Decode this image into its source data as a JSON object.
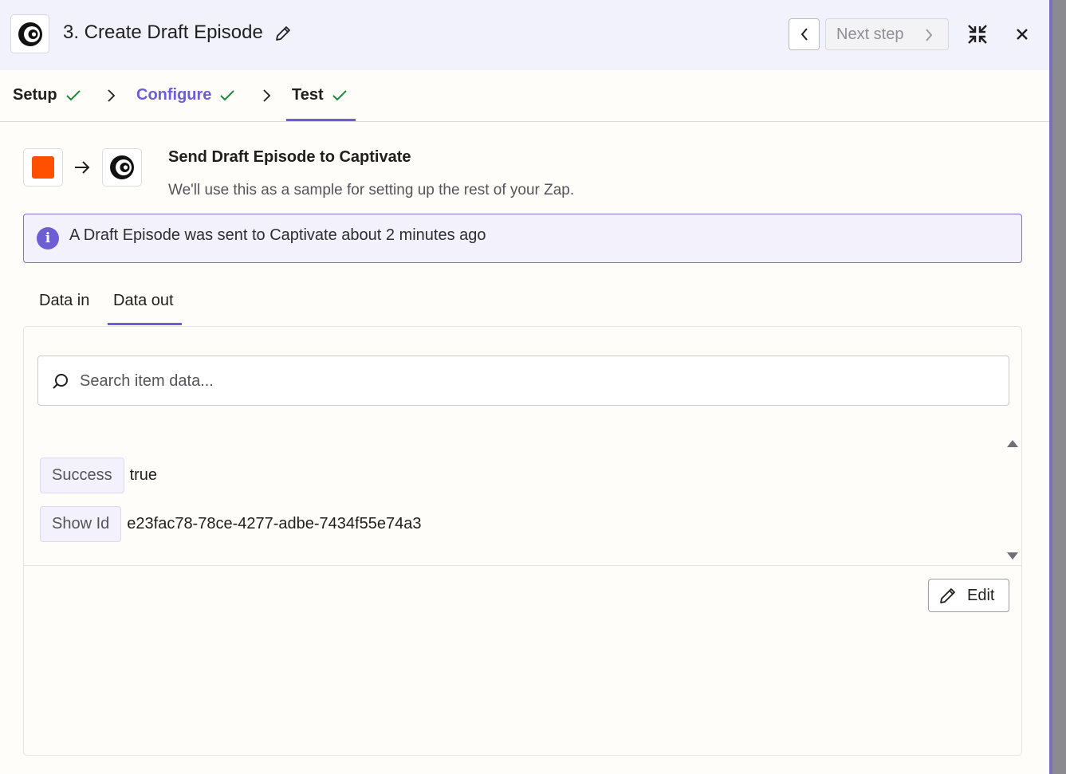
{
  "header": {
    "title": "3. Create Draft Episode",
    "next_step_label": "Next step"
  },
  "steps": [
    {
      "label": "Setup",
      "done": true
    },
    {
      "label": "Configure",
      "done": true,
      "active_color": "#6b5fd3"
    },
    {
      "label": "Test",
      "done": true,
      "current": true
    }
  ],
  "action": {
    "heading": "Send Draft Episode to Captivate",
    "subheading": "We'll use this as a sample for setting up the rest of your Zap."
  },
  "banner": {
    "icon": "i",
    "text": "A Draft Episode was sent to Captivate about 2 minutes ago"
  },
  "data_tabs": {
    "in_label": "Data in",
    "out_label": "Data out",
    "selected": "Data out"
  },
  "search": {
    "placeholder": "Search item data..."
  },
  "data_rows": [
    {
      "key": "Success",
      "value": "true"
    },
    {
      "key": "Show Id",
      "value": "e23fac78-78ce-4277-adbe-7434f55e74a3"
    }
  ],
  "edit_label": "Edit",
  "colors": {
    "accent": "#6b5fd3",
    "check": "#1c8a3c",
    "zapier_orange": "#ff4f00"
  },
  "icons": [
    "captivate-logo-icon",
    "pencil-icon",
    "chevron-left-icon",
    "chevron-right-icon",
    "collapse-icon",
    "close-icon",
    "check-icon",
    "arrow-right-icon",
    "info-icon",
    "search-icon",
    "triangle-up-icon",
    "triangle-down-icon"
  ]
}
